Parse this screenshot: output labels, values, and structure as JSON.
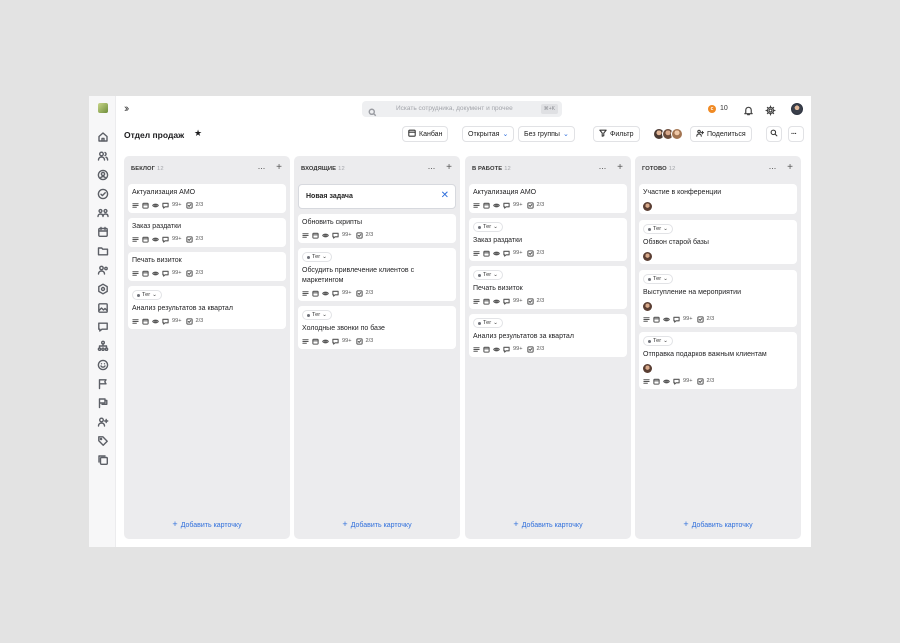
{
  "topbar": {
    "search_placeholder": "Искать сотрудника, документ и прочее",
    "search_shortcut": "⌘+K",
    "coins": "10"
  },
  "header": {
    "title": "Отдел продаж",
    "view": "Канбан",
    "filter_status": "Открытая",
    "grouping": "Без группы",
    "filter": "Фильтр",
    "share": "Поделиться"
  },
  "colors": {
    "accent": "#2f6fdc",
    "coin": "#f08a24",
    "column_bg": "#ececee"
  },
  "board": {
    "add_card_label": "Добавить карточку",
    "new_task_value": "Новая задача",
    "tag_label": "Тег",
    "comments": "99+",
    "checklist": "2/3",
    "columns": [
      {
        "title": "БЕКЛОГ",
        "count": "12",
        "cards": [
          {
            "title": "Актуализация АМО"
          },
          {
            "title": "Заказ раздатки"
          },
          {
            "title": "Печать визиток"
          },
          {
            "title": "Анализ результатов за квартал",
            "tag": true
          }
        ]
      },
      {
        "title": "ВХОДЯЩИЕ",
        "count": "12",
        "cards": [
          {
            "title": "Обновить скрипты"
          },
          {
            "title": "Обсудить привлечение клиентов с",
            "title2": "маркетингом",
            "tag": true
          },
          {
            "title": "Холодные звонки по базе",
            "tag": true
          }
        ]
      },
      {
        "title": "В РАБОТЕ",
        "count": "12",
        "cards": [
          {
            "title": "Актуализация АМО"
          },
          {
            "title": "Заказ раздатки",
            "tag": true
          },
          {
            "title": "Печать визиток",
            "tag": true
          },
          {
            "title": "Анализ результатов за квартал",
            "tag": true
          }
        ]
      },
      {
        "title": "ГОТОВО",
        "count": "12",
        "cards": [
          {
            "title": "Участие в конференции"
          },
          {
            "title": "Обзвон старой базы",
            "tag": true
          },
          {
            "title": "Выступление на мероприятии",
            "tag": true
          },
          {
            "title": "Отправка подарков важным клиентам",
            "tag": true
          }
        ]
      }
    ]
  }
}
